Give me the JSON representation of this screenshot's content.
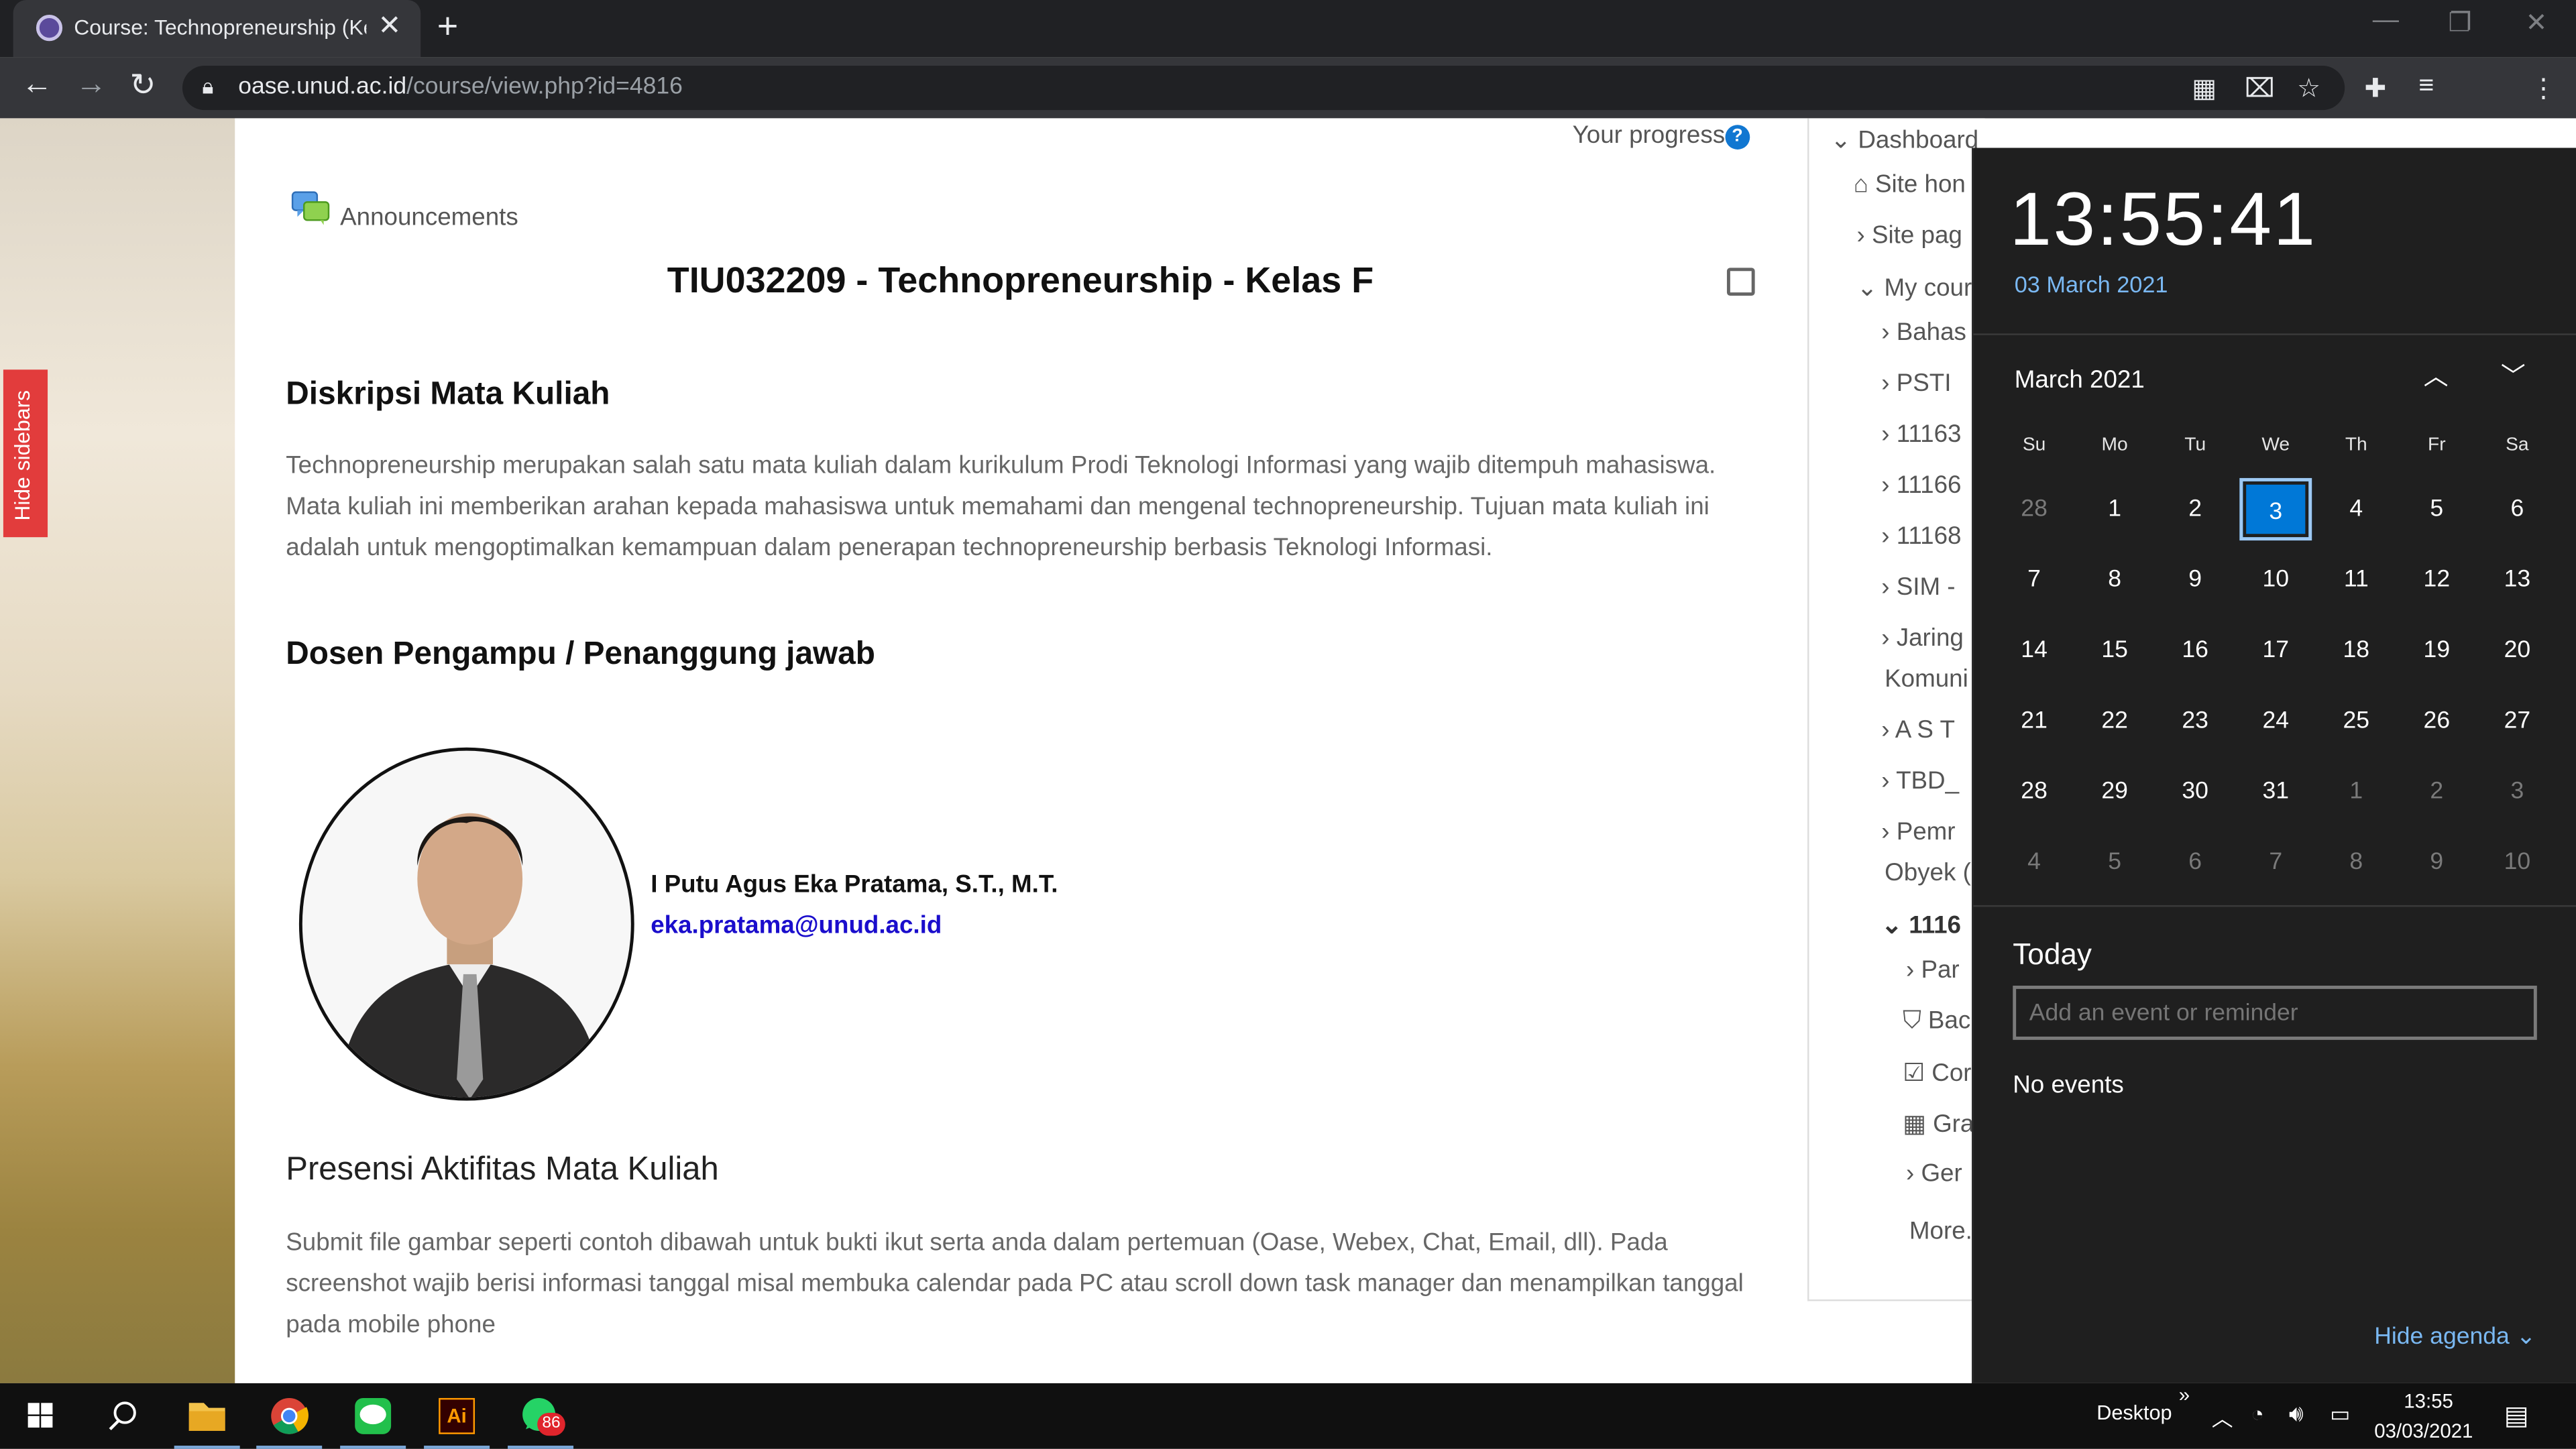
{
  "browser": {
    "tab_title": "Course: Technopreneurship (Kelas F)",
    "url_host": "oase.unud.ac.id",
    "url_path": "/course/view.php?id=4816"
  },
  "page": {
    "hide_sidebars": "Hide sidebars",
    "your_progress": "Your progress",
    "announcements": "Announcements",
    "course_title": "TIU032209 - Technopreneurship - Kelas F",
    "desc_heading": "Diskripsi Mata Kuliah",
    "desc_text": "Technopreneurship merupakan salah satu mata kuliah dalam kurikulum Prodi Teknologi Informasi yang wajib ditempuh mahasiswa. Mata kuliah ini memberikan arahan kepada mahasiswa untuk memahami dan mengenal technopreneurship. Tujuan mata kuliah ini adalah untuk mengoptimalkan kemampuan dalam penerapan technopreneurship berbasis Teknologi Informasi.",
    "lecturer_heading": "Dosen Pengampu / Penanggung jawab",
    "lecturer_name": "I Putu Agus Eka Pratama, S.T., M.T.",
    "lecturer_email": "eka.pratama@unud.ac.id",
    "presensi_heading": "Presensi Aktifitas Mata Kuliah",
    "presensi_text": "Submit file gambar seperti contoh dibawah untuk bukti ikut serta anda dalam pertemuan (Oase, Webex, Chat, Email, dll). Pada screenshot wajib berisi informasi tanggal misal membuka calendar pada PC atau scroll down task manager dan menampilkan tanggal pada mobile phone"
  },
  "nav": {
    "dashboard": "Dashboard",
    "site_home": "Site hon",
    "site_pages": "Site pag",
    "my_courses": "My cour",
    "items": [
      "Bahas",
      "PSTI",
      "11163",
      "11166",
      "11168",
      "SIM -",
      "Jaring"
    ],
    "komuni": "Komuni",
    "ast": "A S T",
    "tbd": "TBD_",
    "pemr": "Pemr",
    "obyek": "Obyek (",
    "current": "1116",
    "sub": [
      "Par",
      "Bac",
      "Cor",
      "Gra",
      "Ger"
    ],
    "more": "More..."
  },
  "clock": {
    "time": "13:55:41",
    "date": "03 March 2021",
    "month": "March 2021",
    "dow": [
      "Su",
      "Mo",
      "Tu",
      "We",
      "Th",
      "Fr",
      "Sa"
    ],
    "weeks": [
      [
        "28",
        "1",
        "2",
        "3",
        "4",
        "5",
        "6"
      ],
      [
        "7",
        "8",
        "9",
        "10",
        "11",
        "12",
        "13"
      ],
      [
        "14",
        "15",
        "16",
        "17",
        "18",
        "19",
        "20"
      ],
      [
        "21",
        "22",
        "23",
        "24",
        "25",
        "26",
        "27"
      ],
      [
        "28",
        "29",
        "30",
        "31",
        "1",
        "2",
        "3"
      ],
      [
        "4",
        "5",
        "6",
        "7",
        "8",
        "9",
        "10"
      ]
    ],
    "selected_day": "3",
    "today_label": "Today",
    "event_placeholder": "Add an event or reminder",
    "no_events": "No events",
    "hide_agenda": "Hide agenda"
  },
  "taskbar": {
    "ai_label": "Ai",
    "whatsapp_badge": "86",
    "desktop": "Desktop",
    "time": "13:55",
    "date": "03/03/2021"
  },
  "colors": {
    "accent": "#0078d7",
    "link": "#1a0dcc",
    "hide_sidebars_bg": "#e23c3c"
  }
}
